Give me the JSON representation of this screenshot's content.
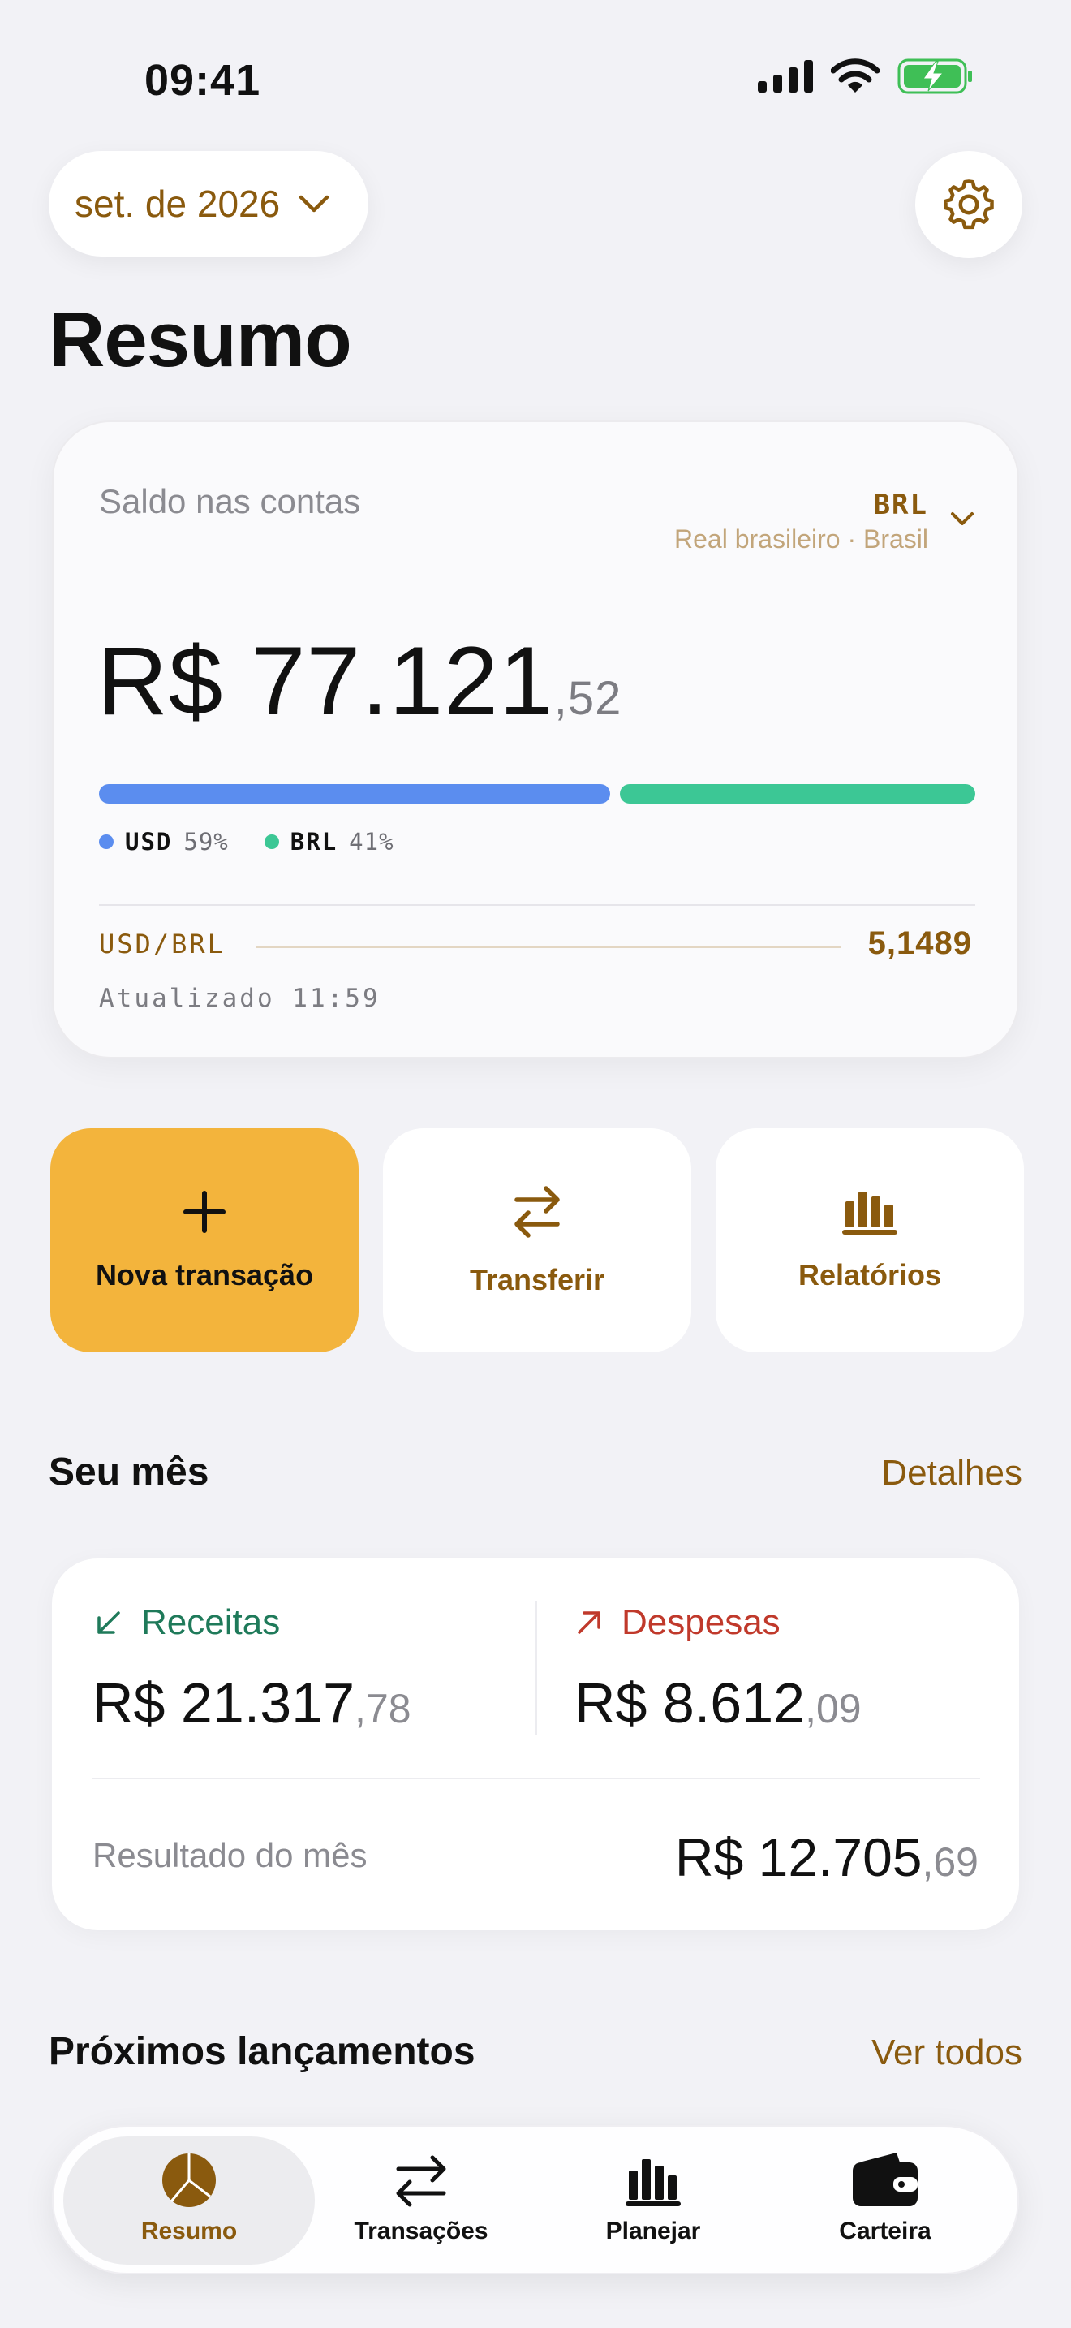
{
  "status_bar": {
    "time": "09:41"
  },
  "header": {
    "month_selector": "set. de 2026",
    "title": "Resumo"
  },
  "balance_card": {
    "label": "Saldo nas contas",
    "currency_code": "BRL",
    "currency_name": "Real brasileiro · Brasil",
    "amount_main": "R$ 77.121",
    "amount_cents": ",52",
    "allocation": [
      {
        "code": "USD",
        "percent_label": "59%",
        "fraction": 0.59,
        "color": "#5b8def"
      },
      {
        "code": "BRL",
        "percent_label": "41%",
        "fraction": 0.41,
        "color": "#3cc795"
      }
    ],
    "rate_pair": "USD/BRL",
    "rate_value": "5,1489",
    "updated": "Atualizado 11:59"
  },
  "actions": [
    {
      "label": "Nova transação",
      "icon": "plus-icon"
    },
    {
      "label": "Transferir",
      "icon": "transfer-arrows-icon"
    },
    {
      "label": "Relatórios",
      "icon": "bar-chart-icon"
    }
  ],
  "month_section": {
    "title": "Seu mês",
    "link": "Detalhes",
    "income": {
      "label": "Receitas",
      "amount_main": "R$ 21.317",
      "amount_cents": ",78",
      "color": "#1f7a5a"
    },
    "expenses": {
      "label": "Despesas",
      "amount_main": "R$ 8.612",
      "amount_cents": ",09",
      "color": "#c0392b"
    },
    "result": {
      "label": "Resultado do mês",
      "amount_main": "R$ 12.705",
      "amount_cents": ",69"
    }
  },
  "upcoming_section": {
    "title": "Próximos lançamentos",
    "link": "Ver todos"
  },
  "tab_bar": {
    "tabs": [
      {
        "label": "Resumo",
        "icon": "pie-chart-icon",
        "active": true
      },
      {
        "label": "Transações",
        "icon": "transfer-arrows-icon",
        "active": false
      },
      {
        "label": "Planejar",
        "icon": "bar-chart-icon",
        "active": false
      },
      {
        "label": "Carteira",
        "icon": "wallet-icon",
        "active": false
      }
    ]
  },
  "colors": {
    "accent": "#8a5a0e",
    "primary_button": "#f3b43c",
    "background": "#f2f2f6"
  }
}
